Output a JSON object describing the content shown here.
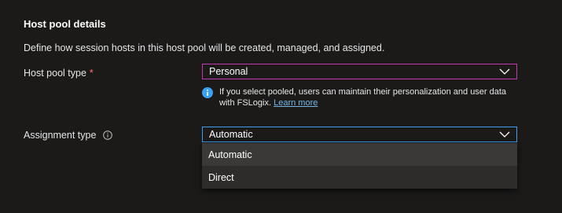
{
  "section": {
    "title": "Host pool details",
    "description": "Define how session hosts in this host pool will be created, managed, and assigned."
  },
  "host_pool_type": {
    "label": "Host pool type",
    "required_marker": "*",
    "selected_value": "Personal",
    "chevron_icon": "chevron-down-icon",
    "info_icon": "info-filled-icon",
    "note_text": "If you select pooled, users can maintain their personalization and user data with FSLogix.",
    "note_link": "Learn more"
  },
  "assignment_type": {
    "label": "Assignment type",
    "info_icon": "info-circle-icon",
    "selected_value": "Automatic",
    "chevron_icon": "chevron-down-icon",
    "options": [
      {
        "label": "Automatic"
      },
      {
        "label": "Direct"
      }
    ]
  },
  "colors": {
    "background": "#1b1a19",
    "focus_border_pink": "#c239b3",
    "focus_border_blue": "#3aa0f3",
    "info_blue": "#3aa0f3",
    "link": "#75b6e7",
    "required": "#ff6f6f"
  }
}
